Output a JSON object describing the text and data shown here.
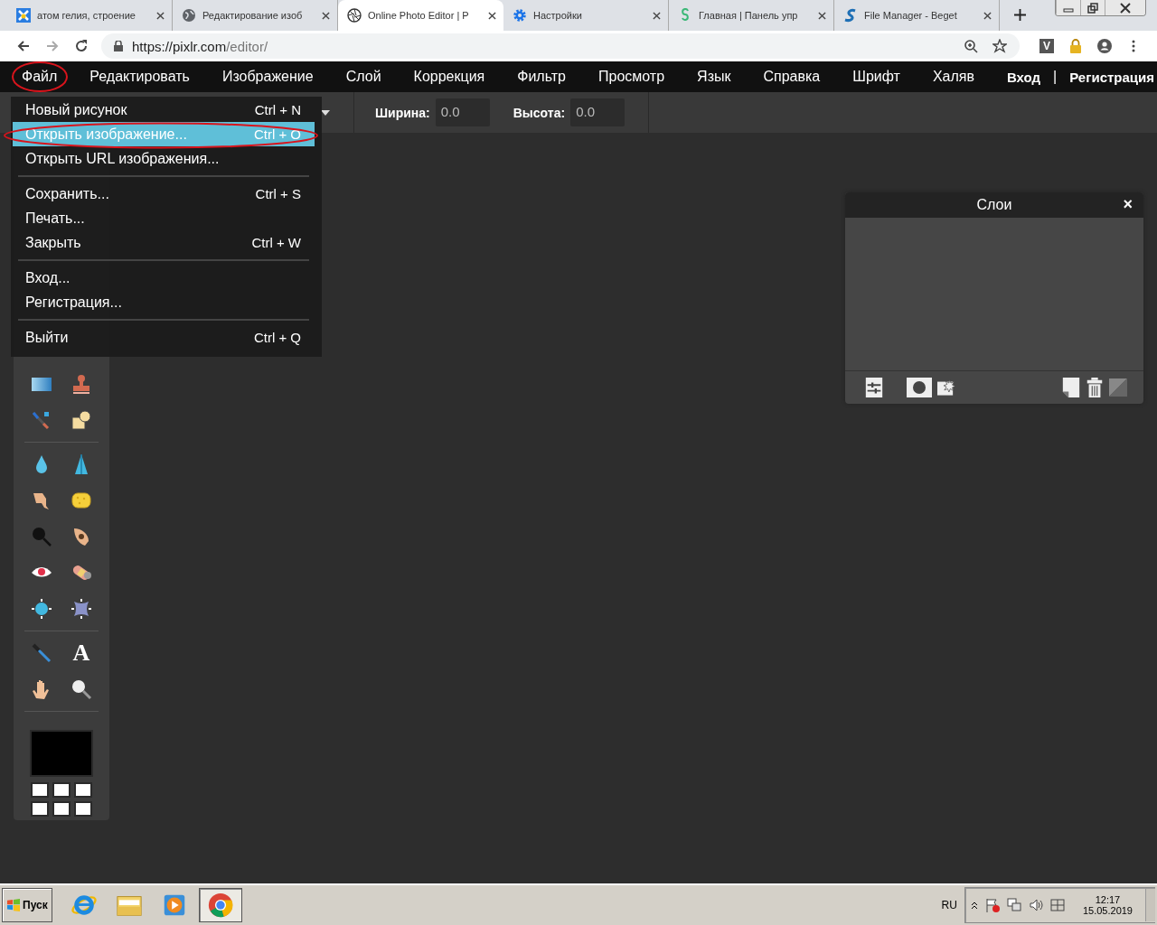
{
  "browser": {
    "tabs": [
      {
        "title": "атом гелия, строение",
        "kind": "x-logo",
        "selected": false
      },
      {
        "title": "Редактирование изоб",
        "kind": "globe",
        "selected": false
      },
      {
        "title": "Online Photo Editor | P",
        "kind": "aperture",
        "selected": true
      },
      {
        "title": "Настройки",
        "kind": "gear",
        "selected": false
      },
      {
        "title": "Главная | Панель упр",
        "kind": "s-logo",
        "selected": false
      },
      {
        "title": "File Manager - Beget",
        "kind": "s-swoosh",
        "selected": false
      }
    ],
    "url_host": "https://pixlr.com",
    "url_path": "/editor/",
    "extension_label": "V"
  },
  "menubar": {
    "items": [
      {
        "label": "Файл"
      },
      {
        "label": "Редактировать"
      },
      {
        "label": "Изображение"
      },
      {
        "label": "Слой"
      },
      {
        "label": "Коррекция"
      },
      {
        "label": "Фильтр"
      },
      {
        "label": "Просмотр"
      },
      {
        "label": "Язык"
      },
      {
        "label": "Справка"
      },
      {
        "label": "Шрифт"
      },
      {
        "label": "Халяв"
      }
    ],
    "login": "Вход",
    "divider": "|",
    "register": "Регистрация"
  },
  "options_bar": {
    "width_label": "Ширина:",
    "width_value": "0.0",
    "height_label": "Высота:",
    "height_value": "0.0"
  },
  "file_menu": {
    "sections": [
      [
        {
          "label": "Новый рисунок",
          "shortcut": "Ctrl + N",
          "selected": false
        },
        {
          "label": "Открыть изображение...",
          "shortcut": "Ctrl + O",
          "selected": true
        },
        {
          "label": "Открыть URL изображения...",
          "selected": false
        }
      ],
      [
        {
          "label": "Сохранить...",
          "shortcut": "Ctrl + S",
          "selected": false
        },
        {
          "label": "Печать...",
          "selected": false
        },
        {
          "label": "Закрыть",
          "shortcut": "Ctrl + W",
          "selected": false
        }
      ],
      [
        {
          "label": "Вход...",
          "selected": false
        },
        {
          "label": "Регистрация...",
          "selected": false
        }
      ],
      [
        {
          "label": "Выйти",
          "shortcut": "Ctrl + Q",
          "selected": false
        }
      ]
    ]
  },
  "toolbox": {
    "text_tool_glyph": "A"
  },
  "layers_panel": {
    "title": "Слои",
    "close": "×"
  },
  "taskbar": {
    "start": "Пуск",
    "apps": [
      {
        "kind": "ie",
        "selected": false
      },
      {
        "kind": "folder",
        "selected": false
      },
      {
        "kind": "media",
        "selected": false
      },
      {
        "kind": "chrome",
        "selected": true
      }
    ],
    "language": "RU",
    "time": "12:17",
    "date": "15.05.2019"
  }
}
